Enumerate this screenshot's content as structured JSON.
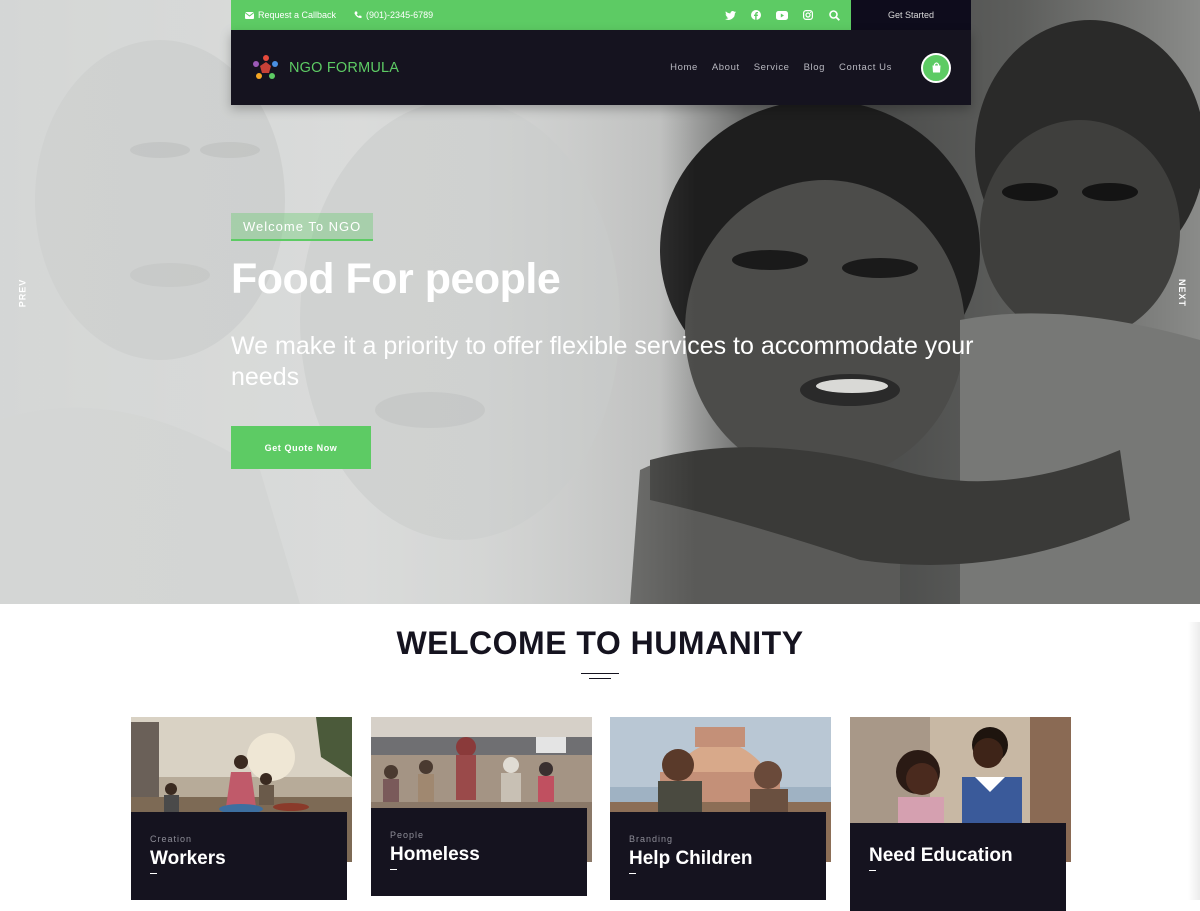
{
  "topbar": {
    "callback_label": "Request a Callback",
    "phone": "(901)-2345-6789",
    "social_icons": [
      "twitter-icon",
      "facebook-icon",
      "youtube-icon",
      "instagram-icon",
      "search-icon"
    ],
    "cta_label": "Get Started"
  },
  "navbar": {
    "logo_text": "NGO FORMULA",
    "menu": [
      "Home",
      "About",
      "Service",
      "Blog",
      "Contact Us"
    ],
    "cart_icon": "shopping-bag-icon"
  },
  "hero": {
    "tag": "Welcome To NGO",
    "title": "Food For people",
    "subtitle": "We make it a priority to offer flexible services to accommodate your needs",
    "button_label": "Get Quote Now",
    "prev_label": "PREV",
    "next_label": "NEXT"
  },
  "welcome": {
    "title": "WELCOME TO HUMANITY",
    "cards": [
      {
        "category": "Creation",
        "title": "Workers"
      },
      {
        "category": "People",
        "title": "Homeless"
      },
      {
        "category": "Branding",
        "title": "Help Children"
      },
      {
        "category": "",
        "title": "Need Education"
      }
    ]
  },
  "colors": {
    "accent": "#5dcb64",
    "dark": "#15131f"
  }
}
